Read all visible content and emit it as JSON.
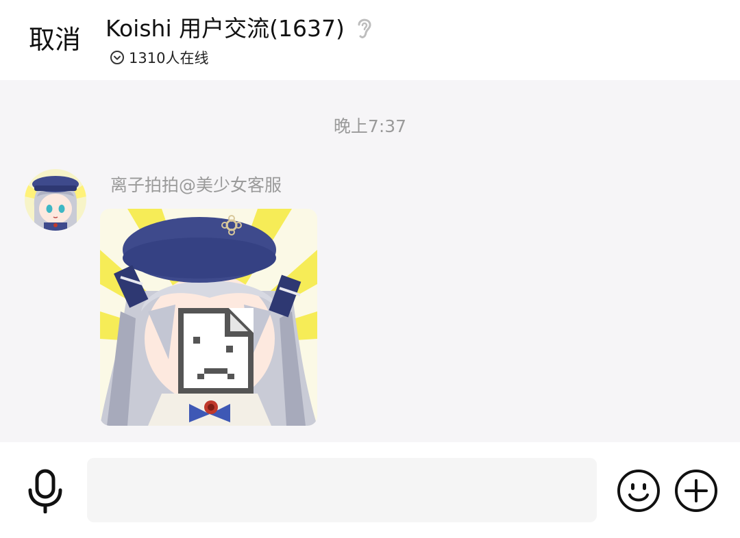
{
  "header": {
    "cancel_label": "取消",
    "title": "Koishi 用户交流(1637)",
    "online_text": "1310人在线",
    "ear_icon": "ear-icon",
    "online_icon": "chevron-down-circle-icon"
  },
  "chat": {
    "timestamp": "晚上7:37",
    "messages": [
      {
        "sender": "离子拍拍@美少女客服",
        "avatar": "anime-girl-avatar",
        "content_type": "image",
        "image_state": "broken-image"
      }
    ]
  },
  "input_bar": {
    "mic_icon": "microphone-icon",
    "input_value": "",
    "emoji_icon": "smiley-icon",
    "plus_icon": "plus-circle-icon"
  },
  "colors": {
    "chat_background": "#f6f5f7",
    "header_background": "#ffffff",
    "timestamp_text": "#9a9a9a",
    "input_background": "#f5f5f5",
    "hat_blue": "#3e4a8c",
    "hair_silver": "#c9cbd6",
    "sunburst_yellow": "#f6ec57"
  }
}
